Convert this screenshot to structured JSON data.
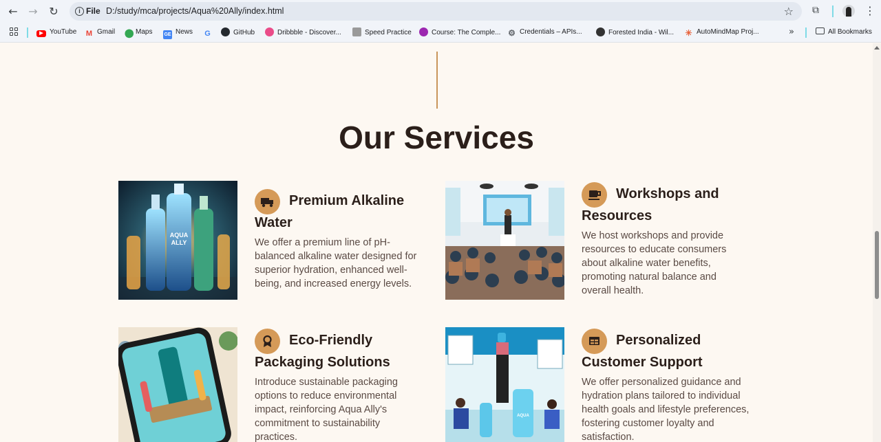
{
  "browser": {
    "url_scheme_label": "File",
    "url": "D:/study/mca/projects/Aqua%20Ally/index.html",
    "bookmarks": [
      {
        "label": "YouTube",
        "icon": "youtube-icon",
        "color": "#ff0000"
      },
      {
        "label": "Gmail",
        "icon": "gmail-icon",
        "color": "#ea4335"
      },
      {
        "label": "Maps",
        "icon": "maps-icon",
        "color": "#34a853"
      },
      {
        "label": "News",
        "icon": "news-icon",
        "color": "#4285f4"
      },
      {
        "label": "",
        "icon": "google-icon",
        "color": "#4285f4"
      },
      {
        "label": "GitHub",
        "icon": "github-icon",
        "color": "#24292e"
      },
      {
        "label": "Dribbble - Discover...",
        "icon": "dribbble-icon",
        "color": "#ea4c89"
      },
      {
        "label": "Speed Practice",
        "icon": "speed-practice-icon",
        "color": "#7a7a7a"
      },
      {
        "label": "Course: The Comple...",
        "icon": "course-icon",
        "color": "#9c27b0"
      },
      {
        "label": "Credentials – APIs...",
        "icon": "credentials-icon",
        "color": "#5f6368"
      },
      {
        "label": "Forested India - Wil...",
        "icon": "wikipedia-icon",
        "color": "#333333"
      },
      {
        "label": "AutoMindMap Proj...",
        "icon": "automindmap-icon",
        "color": "#e8623a"
      }
    ],
    "all_bookmarks_label": "All Bookmarks"
  },
  "section": {
    "title": "Our Services"
  },
  "services": [
    {
      "title": "Premium Alkaline Water",
      "icon": "truck-icon",
      "description": "We offer a premium line of pH-balanced alkaline water designed for superior hydration, enhanced well-being, and increased energy levels.",
      "image": "aqua-ally-bottles-image"
    },
    {
      "title": "Workshops and Resources",
      "icon": "coffee-cup-icon",
      "description": "We host workshops and provide resources to educate consumers about alkaline water benefits, promoting natural balance and overall health.",
      "image": "workshop-audience-image"
    },
    {
      "title": "Eco-Friendly Packaging Solutions",
      "icon": "award-icon",
      "description": "Introduce sustainable packaging options to reduce environmental impact, reinforcing Aqua Ally's commitment to sustainability practices.",
      "image": "sustainable-packaging-phone-image"
    },
    {
      "title": "Personalized Customer Support",
      "icon": "table-icon",
      "description": "We offer personalized guidance and hydration plans tailored to individual health goals and lifestyle preferences, fostering customer loyalty and satisfaction.",
      "image": "hydration-lifestyle-image"
    }
  ],
  "colors": {
    "page_bg": "#fdf8f2",
    "accent": "#d59a58",
    "heading": "#2b1f1a",
    "body_text": "#5a4a44"
  }
}
